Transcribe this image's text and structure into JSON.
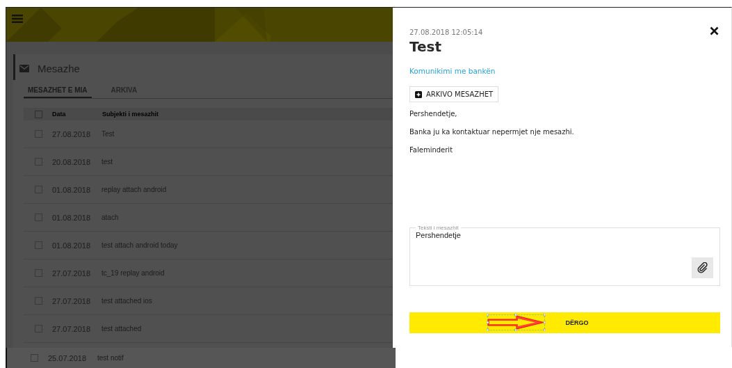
{
  "page_title": "Mesazhe",
  "tabs": [
    {
      "label": "MESAZHET E MIA",
      "selected": true
    },
    {
      "label": "ARKIVA",
      "selected": false
    }
  ],
  "table": {
    "columns": [
      "Data",
      "Subjekti i mesazhit"
    ],
    "select_all_checked": false,
    "rows": [
      {
        "date": "27.08.2018",
        "subject": "Test",
        "checked": false
      },
      {
        "date": "20.08.2018",
        "subject": "test",
        "checked": false
      },
      {
        "date": "01.08.2018",
        "subject": "replay attach android",
        "checked": false
      },
      {
        "date": "01.08.2018",
        "subject": "atach",
        "checked": false
      },
      {
        "date": "01.08.2018",
        "subject": "test attach android today",
        "checked": false
      },
      {
        "date": "27.07.2018",
        "subject": "tc_19 replay android",
        "checked": false
      },
      {
        "date": "27.07.2018",
        "subject": "test attached ios",
        "checked": false
      },
      {
        "date": "27.07.2018",
        "subject": "test attached",
        "checked": false
      },
      {
        "date": "25.07.2018",
        "subject": "test notif",
        "checked": false
      }
    ]
  },
  "message": {
    "timestamp": "27.08.2018 12:05:14",
    "title": "Test",
    "category": "Komunikimi me bankën",
    "archive_button": "ARKIVO MESAZHET",
    "body": [
      "Pershendetje,",
      "Banka ju ka kontaktuar nepermjet nje mesazhi.",
      "Faleminderit"
    ],
    "reply": {
      "label": "Teksti i mesazhit",
      "value": "Pershendetje"
    },
    "send_button": "DËRGO"
  }
}
